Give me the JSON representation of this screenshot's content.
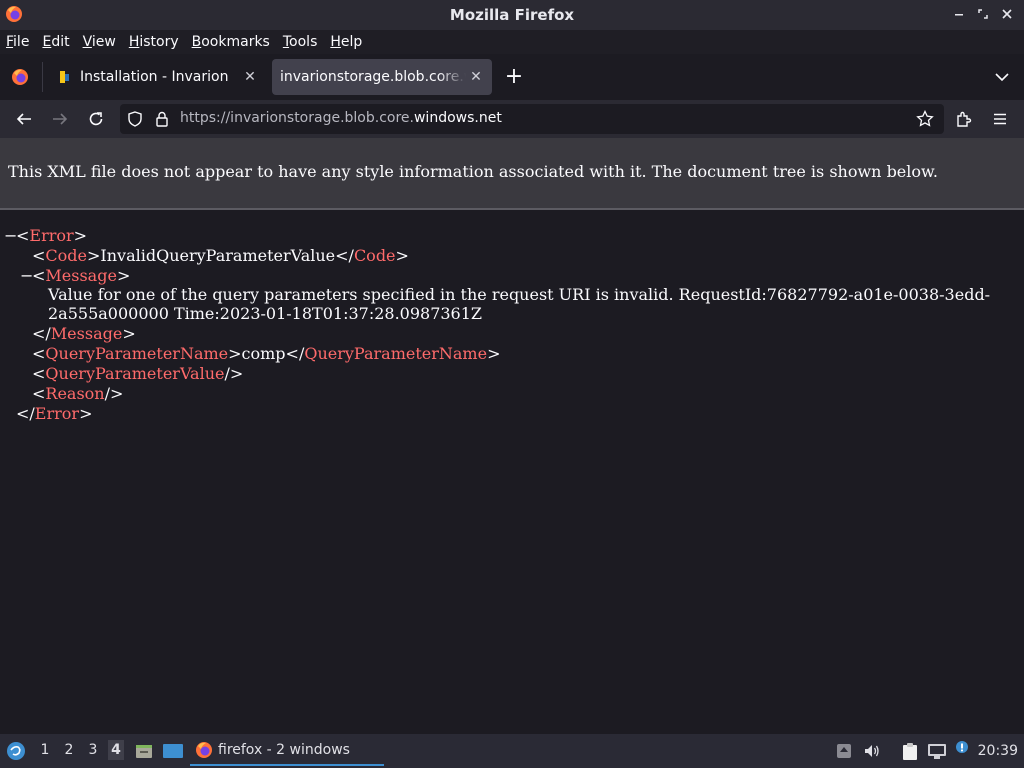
{
  "window": {
    "title": "Mozilla Firefox"
  },
  "menu": {
    "items": [
      {
        "label": "File",
        "accel": "F",
        "rest": "ile"
      },
      {
        "label": "Edit",
        "accel": "E",
        "rest": "dit"
      },
      {
        "label": "View",
        "accel": "V",
        "rest": "iew"
      },
      {
        "label": "History",
        "accel": "H",
        "rest": "istory"
      },
      {
        "label": "Bookmarks",
        "accel": "B",
        "rest": "ookmarks"
      },
      {
        "label": "Tools",
        "accel": "T",
        "rest": "ools"
      },
      {
        "label": "Help",
        "accel": "H",
        "rest": "elp"
      }
    ]
  },
  "tabs": [
    {
      "label": "Installation - Invarion",
      "active": false
    },
    {
      "label": "invarionstorage.blob.core.windows.net",
      "active": true
    }
  ],
  "url": {
    "prefix": "https://invarionstorage.blob.core.",
    "domain": "windows.net"
  },
  "xml_info": "This XML file does not appear to have any style information associated with it. The document tree is shown below.",
  "xml": {
    "root": "Error",
    "code_tag": "Code",
    "code_value": "InvalidQueryParameterValue",
    "message_tag": "Message",
    "message_line1": "Value for one of the query parameters specified in the request URI is invalid. RequestId:76827792-a01e-0038-3edd-",
    "message_line2": "2a555a000000 Time:2023-01-18T01:37:28.0987361Z",
    "qpn_tag": "QueryParameterName",
    "qpn_value": "comp",
    "qpv_tag": "QueryParameterValue",
    "reason_tag": "Reason"
  },
  "taskbar": {
    "workspaces": [
      "1",
      "2",
      "3",
      "4"
    ],
    "active_workspace": "4",
    "task_label": "firefox - 2 windows",
    "clock": "20:39"
  },
  "colors": {
    "accent": "#3d8fd1",
    "xml_tag": "#ff6b6b"
  }
}
